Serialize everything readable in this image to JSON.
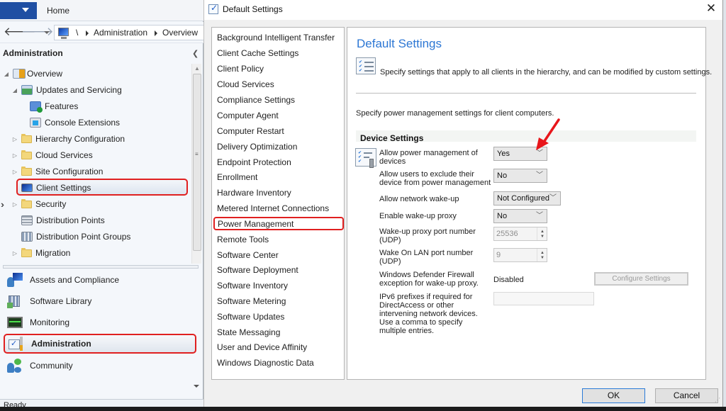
{
  "console": {
    "file_tab_icon": "dropdown-caret-icon",
    "home_tab": "Home",
    "breadcrumb": {
      "root": "\\",
      "items": [
        "Administration",
        "Overview"
      ]
    },
    "workspace_header": "Administration",
    "tree": [
      {
        "label": "Overview",
        "icon": "overview-icon",
        "expanded": true
      },
      {
        "label": "Updates and Servicing",
        "icon": "updates-servicing-icon",
        "expanded": true
      },
      {
        "label": "Features",
        "icon": "features-icon"
      },
      {
        "label": "Console Extensions",
        "icon": "console-extensions-icon"
      },
      {
        "label": "Hierarchy Configuration",
        "icon": "folder-icon",
        "expanded": false
      },
      {
        "label": "Cloud Services",
        "icon": "folder-icon",
        "expanded": false
      },
      {
        "label": "Site Configuration",
        "icon": "folder-icon",
        "expanded": false
      },
      {
        "label": "Client Settings",
        "icon": "client-settings-icon",
        "selected": true
      },
      {
        "label": "Security",
        "icon": "folder-icon",
        "expanded": false
      },
      {
        "label": "Distribution Points",
        "icon": "distribution-points-icon"
      },
      {
        "label": "Distribution Point Groups",
        "icon": "distribution-point-groups-icon"
      },
      {
        "label": "Migration",
        "icon": "folder-icon",
        "expanded": false
      }
    ],
    "wunderbar": [
      {
        "label": "Assets and Compliance",
        "icon": "assets-compliance-icon"
      },
      {
        "label": "Software Library",
        "icon": "software-library-icon"
      },
      {
        "label": "Monitoring",
        "icon": "monitoring-icon"
      },
      {
        "label": "Administration",
        "icon": "administration-icon",
        "selected": true
      },
      {
        "label": "Community",
        "icon": "community-icon"
      }
    ],
    "status": "Ready"
  },
  "dialog": {
    "title": "Default Settings",
    "close_glyph": "✕",
    "categories": [
      "Background Intelligent Transfer",
      "Client Cache Settings",
      "Client Policy",
      "Cloud Services",
      "Compliance Settings",
      "Computer Agent",
      "Computer Restart",
      "Delivery Optimization",
      "Endpoint Protection",
      "Enrollment",
      "Hardware Inventory",
      "Metered Internet Connections",
      "Power Management",
      "Remote Tools",
      "Software Center",
      "Software Deployment",
      "Software Inventory",
      "Software Metering",
      "Software Updates",
      "State Messaging",
      "User and Device Affinity",
      "Windows Diagnostic Data"
    ],
    "selected_category": "Power Management",
    "content": {
      "title": "Default Settings",
      "description": "Specify settings that apply to all clients in the hierarchy, and can be modified by custom settings.",
      "section_description": "Specify power management settings for client computers.",
      "group_heading": "Device Settings",
      "settings": {
        "allow_power_mgmt": {
          "label": "Allow power management of devices",
          "value": "Yes"
        },
        "allow_exclude": {
          "label": "Allow users to exclude their device from power management",
          "value": "No"
        },
        "network_wakeup": {
          "label": "Allow network wake-up",
          "value": "Not Configured"
        },
        "wakeup_proxy": {
          "label": "Enable wake-up proxy",
          "value": "No"
        },
        "proxy_port": {
          "label": "Wake-up proxy port number (UDP)",
          "value": "25536"
        },
        "wol_port": {
          "label": "Wake On LAN port number (UDP)",
          "value": "9"
        },
        "firewall": {
          "label": "Windows Defender Firewall exception for wake-up proxy.",
          "value": "Disabled",
          "button": "Configure Settings"
        },
        "ipv6": {
          "label": "IPv6 prefixes if required for DirectAccess or other intervening network devices. Use a comma to specify multiple entries.",
          "value": ""
        }
      }
    },
    "ok_label": "OK",
    "cancel_label": "Cancel"
  },
  "colors": {
    "accent_blue": "#2d77d4",
    "highlight_red": "#e02020"
  }
}
